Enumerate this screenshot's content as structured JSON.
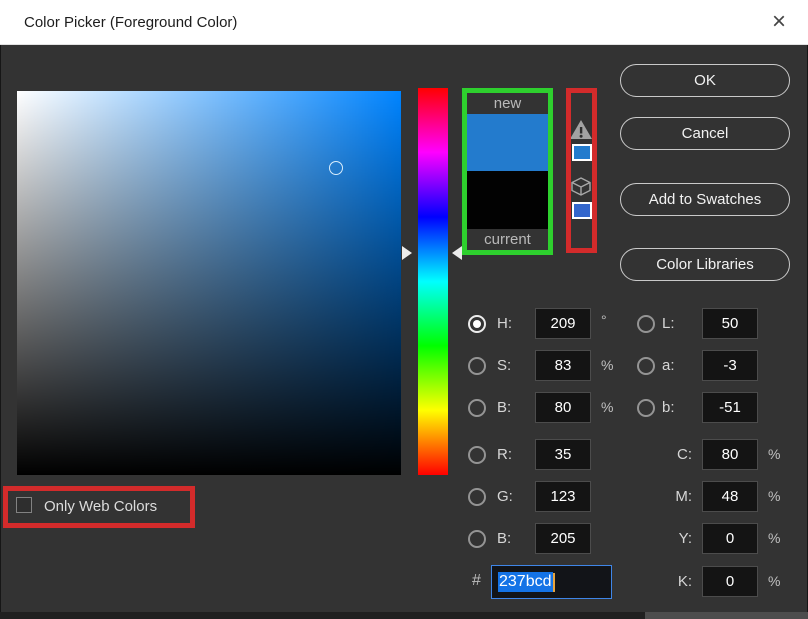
{
  "window": {
    "title": "Color Picker (Foreground Color)",
    "close_glyph": "×"
  },
  "swatch_panel": {
    "new_label": "new",
    "current_label": "current",
    "new_color": "#237bcd",
    "current_color": "#020202"
  },
  "gamut_icons": {
    "gamut_warning_swatch": "#237bcd",
    "websafe_swatch": "#3366cc"
  },
  "action_buttons": {
    "ok": "OK",
    "cancel": "Cancel",
    "add_to_swatches": "Add to Swatches",
    "color_libraries": "Color Libraries"
  },
  "inputs": {
    "h": {
      "label": "H:",
      "value": "209",
      "unit": "°"
    },
    "s": {
      "label": "S:",
      "value": "83",
      "unit": "%"
    },
    "b_hsb": {
      "label": "B:",
      "value": "80",
      "unit": "%"
    },
    "r": {
      "label": "R:",
      "value": "35"
    },
    "g": {
      "label": "G:",
      "value": "123"
    },
    "b_rgb": {
      "label": "B:",
      "value": "205"
    },
    "l": {
      "label": "L:",
      "value": "50"
    },
    "a": {
      "label": "a:",
      "value": "-3"
    },
    "b_lab": {
      "label": "b:",
      "value": "-51"
    },
    "c": {
      "label": "C:",
      "value": "80",
      "unit": "%"
    },
    "m": {
      "label": "M:",
      "value": "48",
      "unit": "%"
    },
    "y": {
      "label": "Y:",
      "value": "0",
      "unit": "%"
    },
    "k": {
      "label": "K:",
      "value": "0",
      "unit": "%"
    }
  },
  "hex": {
    "label": "#",
    "value": "237bcd"
  },
  "options": {
    "only_web_colors": "Only Web Colors"
  },
  "colors": {
    "annotation_green": "#2ed02e",
    "annotation_red": "#d32b2b",
    "hue_base": "#0084ff",
    "selection_blue": "#1473e6"
  }
}
